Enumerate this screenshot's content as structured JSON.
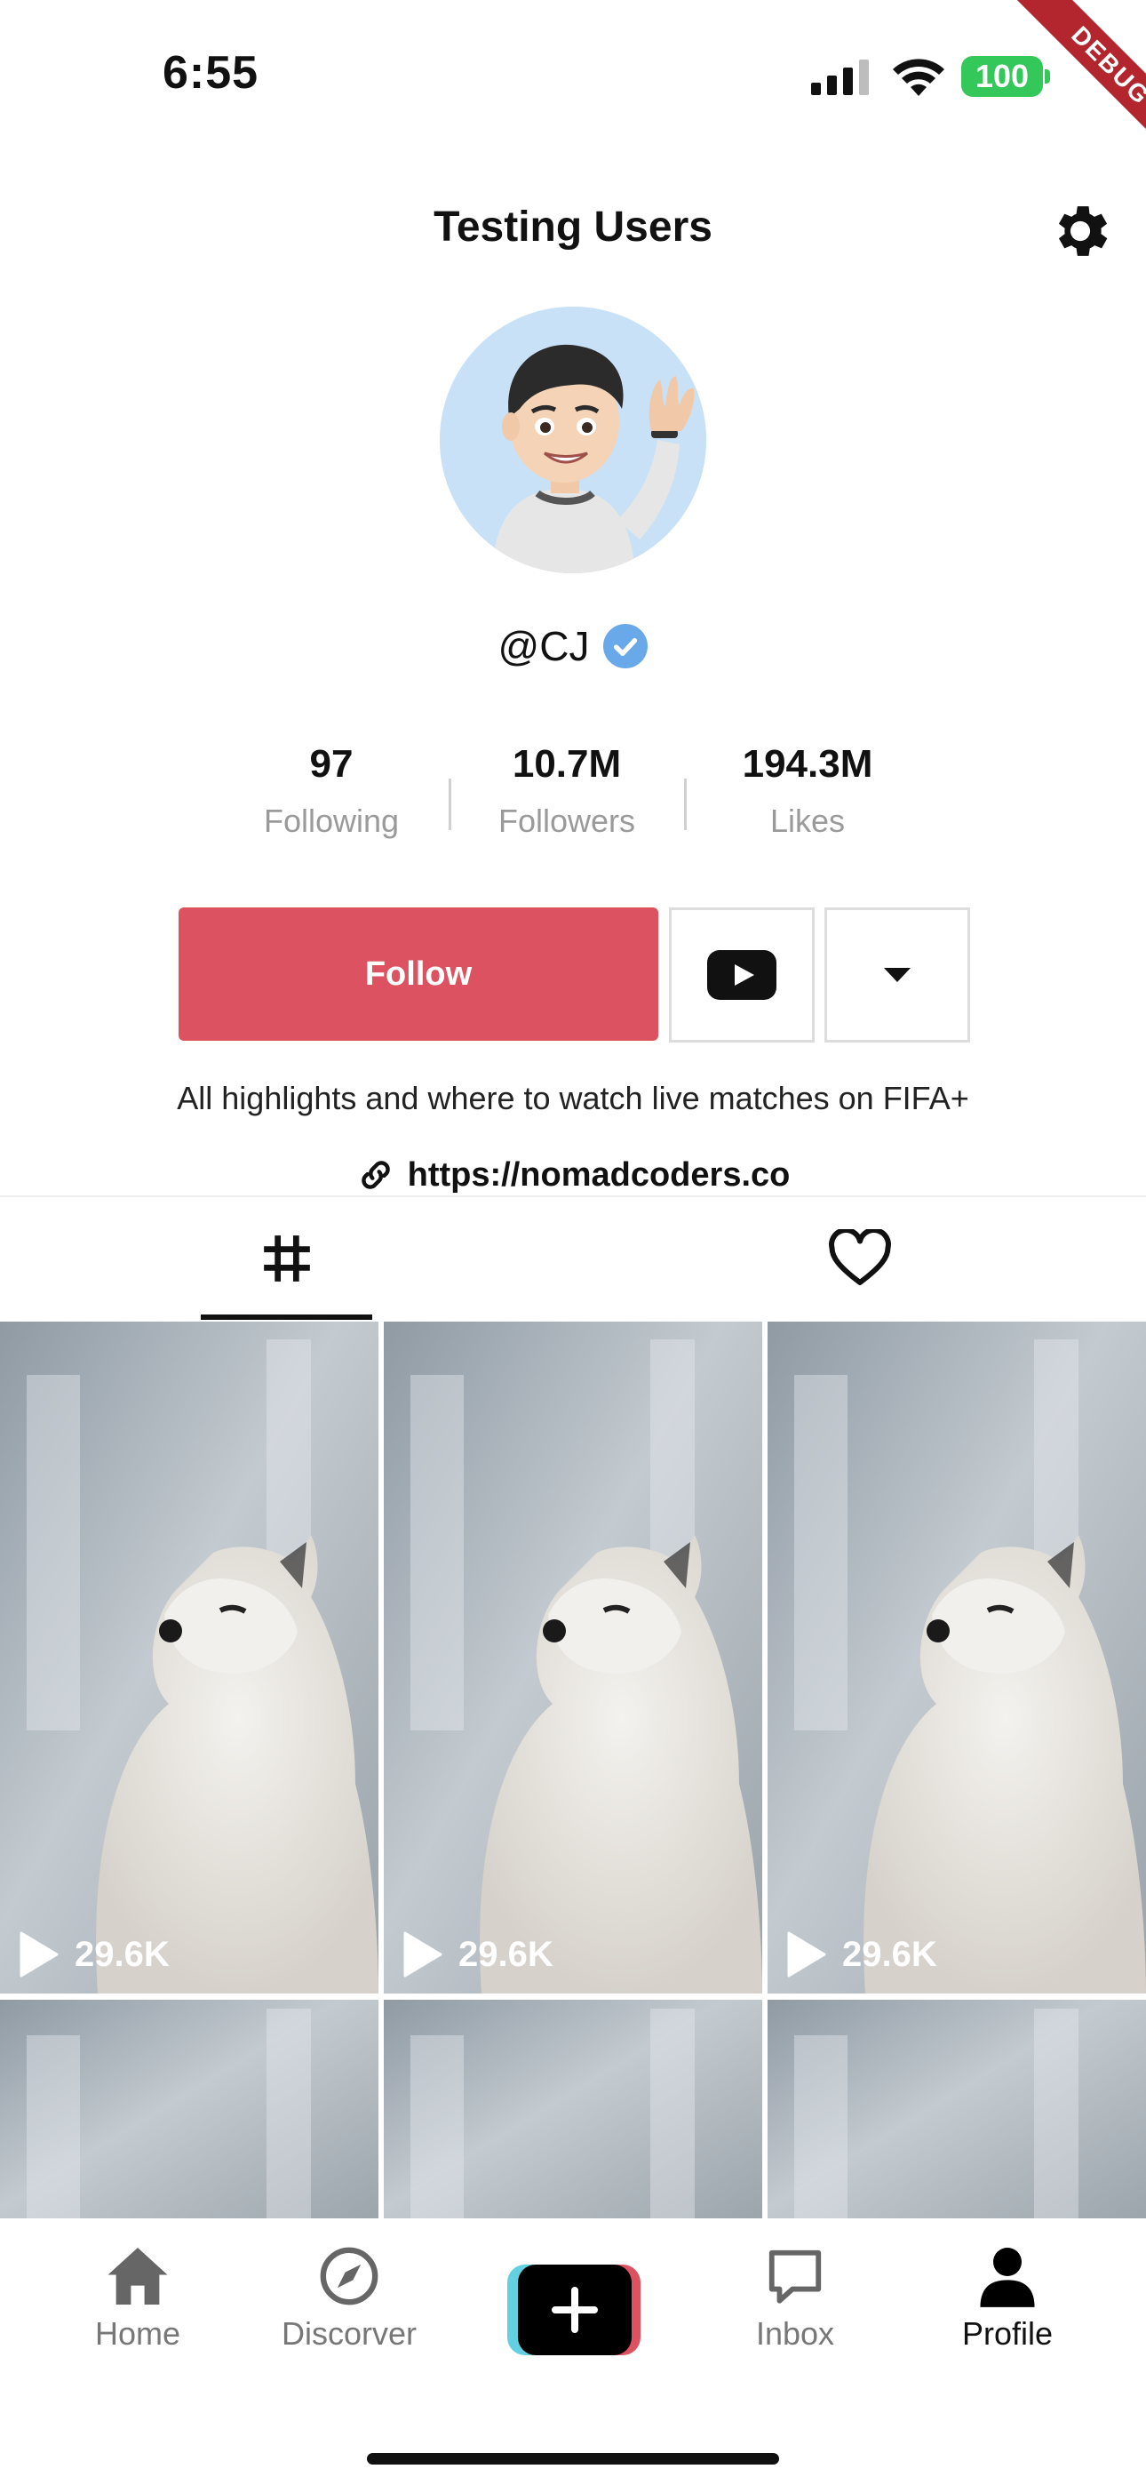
{
  "status_bar": {
    "time": "6:55",
    "battery": "100",
    "debug_banner": "DEBUG"
  },
  "header": {
    "title": "Testing Users"
  },
  "profile": {
    "username": "@CJ",
    "verified": true,
    "stats": [
      {
        "value": "97",
        "label": "Following"
      },
      {
        "value": "10.7M",
        "label": "Followers"
      },
      {
        "value": "194.3M",
        "label": "Likes"
      }
    ],
    "follow_label": "Follow",
    "bio": "All highlights and where to watch live matches on FIFA+",
    "link": "https://nomadcoders.co"
  },
  "tabs": [
    {
      "icon": "grid-icon",
      "active": true
    },
    {
      "icon": "heart-icon",
      "active": false
    }
  ],
  "videos": [
    {
      "views": "29.6K"
    },
    {
      "views": "29.6K"
    },
    {
      "views": "29.6K"
    }
  ],
  "bottom_nav": [
    {
      "label": "Home",
      "icon": "home-icon",
      "active": false
    },
    {
      "label": "Discorver",
      "icon": "compass-icon",
      "active": false
    },
    {
      "label": "",
      "icon": "plus-icon",
      "active": false
    },
    {
      "label": "Inbox",
      "icon": "message-icon",
      "active": false
    },
    {
      "label": "Profile",
      "icon": "user-icon",
      "active": true
    }
  ],
  "colors": {
    "accent": "#dc5260",
    "verified": "#6aa9e9",
    "cyan": "#62d0e0"
  }
}
